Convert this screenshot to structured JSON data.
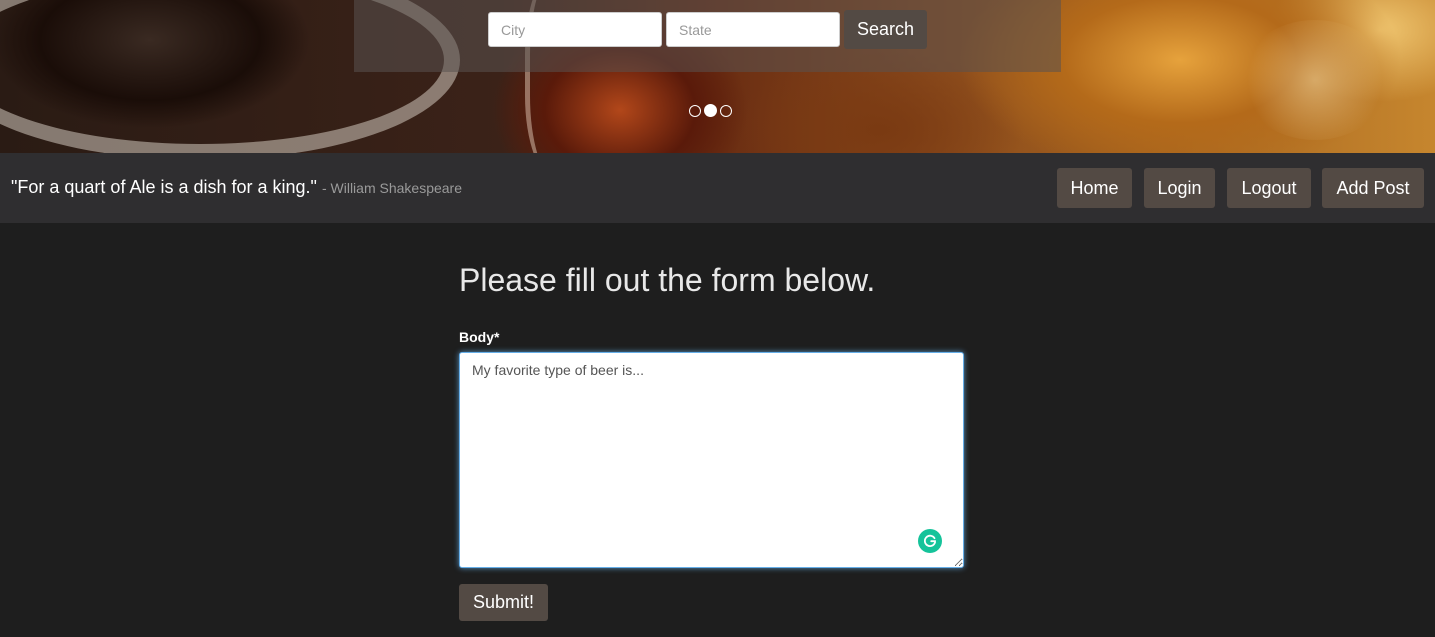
{
  "search": {
    "city_placeholder": "City",
    "state_placeholder": "State",
    "button_label": "Search"
  },
  "carousel": {
    "slide_count": 3,
    "active_slide": 2
  },
  "quote": {
    "text": "\"For a quart of Ale is a dish for a king.\"",
    "author": "- William Shakespeare"
  },
  "nav": {
    "home": "Home",
    "login": "Login",
    "logout": "Logout",
    "add_post": "Add Post"
  },
  "form": {
    "title": "Please fill out the form below.",
    "body_label": "Body*",
    "body_placeholder": "My favorite type of beer is...",
    "submit_label": "Submit!"
  },
  "colors": {
    "page_bg": "#1e1e1e",
    "navbar_bg": "#2f2e30",
    "button_bg": "#534a44",
    "grammarly": "#15c39a"
  }
}
